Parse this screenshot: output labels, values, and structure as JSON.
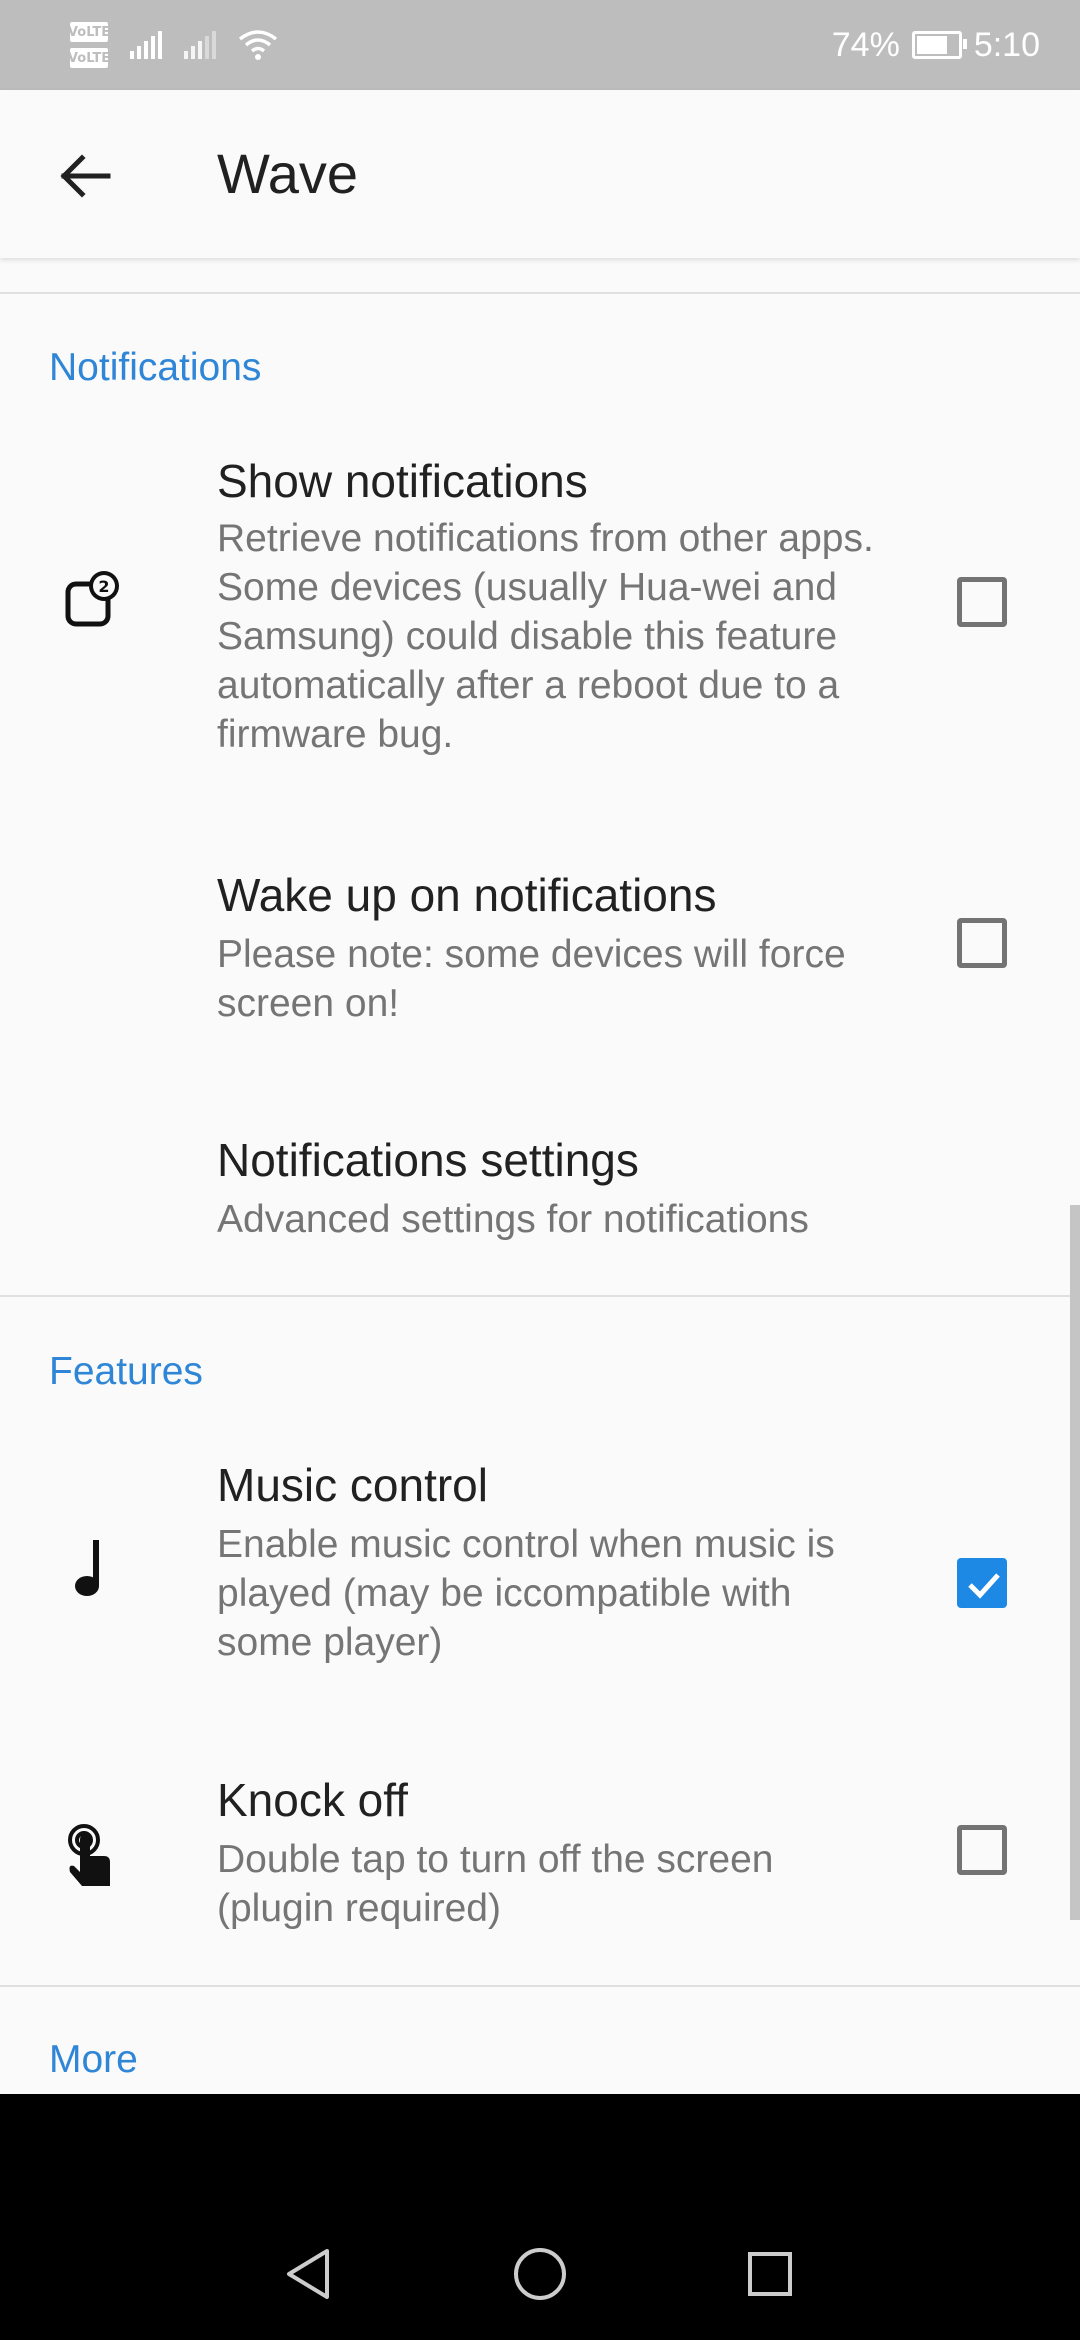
{
  "status_bar": {
    "volte_1": "VoLTE",
    "volte_2": "VoLTE",
    "battery_percent": "74%",
    "battery_level": 0.74,
    "time": "5:10"
  },
  "app_bar": {
    "back_icon": "arrow-left-icon",
    "title": "Wave"
  },
  "sections": {
    "notifications": {
      "title": "Notifications",
      "items": [
        {
          "title": "Show notifications",
          "summary": "Retrieve notifications from other apps. Some devices (usually Hua-wei and Samsung) could disable this feature automatically after a reboot due to a firmware bug.",
          "icon": "notification-badge-icon",
          "checked": false
        },
        {
          "title": "Wake up on notifications",
          "summary": "Please note: some devices will force screen on!",
          "checked": false
        },
        {
          "title": "Notifications settings",
          "summary": "Advanced settings for notifications"
        }
      ]
    },
    "features": {
      "title": "Features",
      "items": [
        {
          "title": "Music control",
          "summary": "Enable music control when music is played (may be iccompatible with some player)",
          "icon": "music-note-icon",
          "checked": true
        },
        {
          "title": "Knock off",
          "summary": "Double tap to turn off the screen (plugin required)",
          "icon": "tap-gesture-icon",
          "checked": false
        }
      ]
    },
    "more": {
      "title": "More"
    }
  },
  "nav_bar": {
    "back": "back-triangle-icon",
    "home": "home-circle-icon",
    "recents": "recents-square-icon"
  },
  "colors": {
    "accent": "#2f86d6",
    "checkbox_checked": "#1e88e5",
    "status_bar": "#bdbdbd",
    "background": "#fafafa"
  }
}
